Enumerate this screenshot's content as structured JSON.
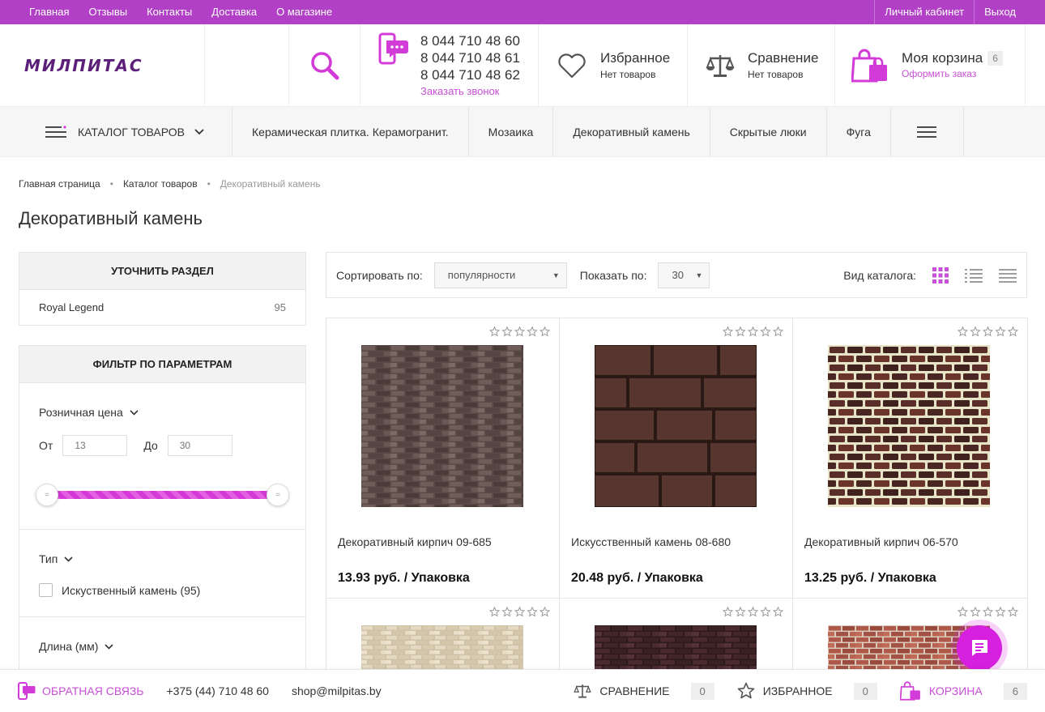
{
  "topbar": {
    "links": [
      "Главная",
      "Отзывы",
      "Контакты",
      "Доставка",
      "О магазине"
    ],
    "account": "Личный кабинет",
    "logout": "Выход"
  },
  "header": {
    "logo": "МИЛПИТАС",
    "phones": [
      "8 044 710 48 60",
      "8 044 710 48 61",
      "8 044 710 48 62"
    ],
    "callback": "Заказать звонок",
    "favorites": {
      "title": "Избранное",
      "sub": "Нет товаров"
    },
    "compare": {
      "title": "Сравнение",
      "sub": "Нет товаров"
    },
    "cart": {
      "title": "Моя корзина",
      "count": "6",
      "sub": "Оформить заказ"
    }
  },
  "nav": {
    "catalog": "КАТАЛОГ ТОВАРОВ",
    "items": [
      "Керамическая плитка. Керамогранит.",
      "Мозаика",
      "Декоративный камень",
      "Скрытые люки",
      "Фуга"
    ]
  },
  "breadcrumb": [
    "Главная страница",
    "Каталог товаров",
    "Декоративный камень"
  ],
  "page_title": "Декоративный камень",
  "sidebar": {
    "section_title": "УТОЧНИТЬ РАЗДЕЛ",
    "section_items": [
      {
        "name": "Royal Legend",
        "count": "95"
      }
    ],
    "filter_title": "ФИЛЬТР ПО ПАРАМЕТРАМ",
    "price": {
      "label": "Розничная цена",
      "from_label": "От",
      "to_label": "До",
      "from_placeholder": "13",
      "to_placeholder": "30"
    },
    "type": {
      "label": "Тип",
      "option": "Искуственный камень (95)"
    },
    "length": {
      "label": "Длина (мм)"
    }
  },
  "toolbar": {
    "sort_label": "Сортировать по:",
    "sort_value": "популярности",
    "show_label": "Показать по:",
    "show_value": "30",
    "view_label": "Вид каталога:"
  },
  "products": [
    {
      "name": "Декоративный кирпич 09-685",
      "price": "13.93 руб. / Упаковка"
    },
    {
      "name": "Искусственный камень 08-680",
      "price": "20.48 руб. / Упаковка"
    },
    {
      "name": "Декоративный кирпич 06-570",
      "price": "13.25 руб. / Упаковка"
    }
  ],
  "footer": {
    "feedback": "ОБРАТНАЯ СВЯЗЬ",
    "phone": "+375 (44) 710 48 60",
    "email": "shop@milpitas.by",
    "compare": "СРАВНЕНИЕ",
    "compare_count": "0",
    "favorites": "ИЗБРАННОЕ",
    "favorites_count": "0",
    "cart": "КОРЗИНА",
    "cart_count": "6"
  },
  "colors": {
    "accent": "#b240c7",
    "brand_pink": "#c84fd8"
  }
}
